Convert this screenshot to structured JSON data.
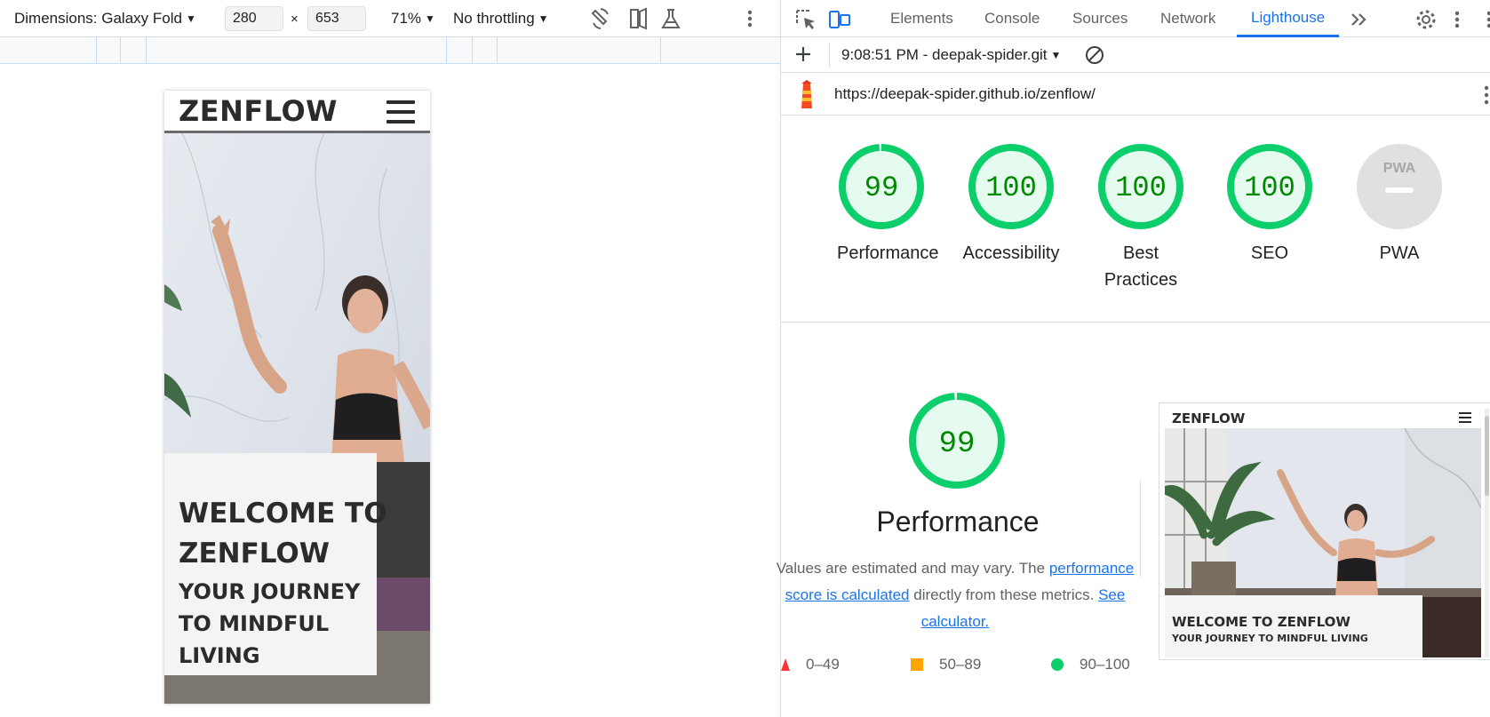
{
  "device_toolbar": {
    "dimensions_label": "Dimensions: Galaxy Fold",
    "width_value": "280",
    "times": "×",
    "height_value": "653",
    "zoom": "71%",
    "throttling": "No throttling"
  },
  "site": {
    "logo": "ZENFLOW",
    "hero_title_line1": "WELCOME TO",
    "hero_title_line2": "ZENFLOW",
    "hero_sub_line1": "YOUR JOURNEY",
    "hero_sub_line2": "TO MINDFUL",
    "hero_sub_line3": "LIVING"
  },
  "devtools": {
    "tabs": [
      "Elements",
      "Console",
      "Sources",
      "Network",
      "Lighthouse"
    ],
    "active_tab": "Lighthouse",
    "report_label": "9:08:51 PM - deepak-spider.git",
    "url": "https://deepak-spider.github.io/zenflow/"
  },
  "scores": [
    {
      "label": "Performance",
      "value": "99",
      "fraction": 0.99
    },
    {
      "label": "Accessibility",
      "value": "100",
      "fraction": 1.0
    },
    {
      "label": "Best Practices",
      "value": "100",
      "fraction": 1.0
    },
    {
      "label": "SEO",
      "value": "100",
      "fraction": 1.0
    },
    {
      "label": "PWA",
      "value": "PWA",
      "fraction": 0
    }
  ],
  "performance": {
    "score": "99",
    "fraction": 0.99,
    "title": "Performance",
    "desc_pre": "Values are estimated and may vary. The ",
    "desc_link": "performance score is calculated",
    "desc_mid": " directly from these metrics. ",
    "desc_link2": "See calculator."
  },
  "legend": {
    "fail": "0–49",
    "average": "50–89",
    "pass": "90–100"
  },
  "thumbnail": {
    "logo": "ZENFLOW",
    "title": "WELCOME TO ZENFLOW",
    "subtitle": "YOUR JOURNEY TO MINDFUL LIVING"
  },
  "colors": {
    "pass": "#0cce6b",
    "pass_text": "#008800",
    "pass_fill": "#e6fbef",
    "pwa_gray": "#e0e0e0",
    "accent": "#1a73e8"
  }
}
